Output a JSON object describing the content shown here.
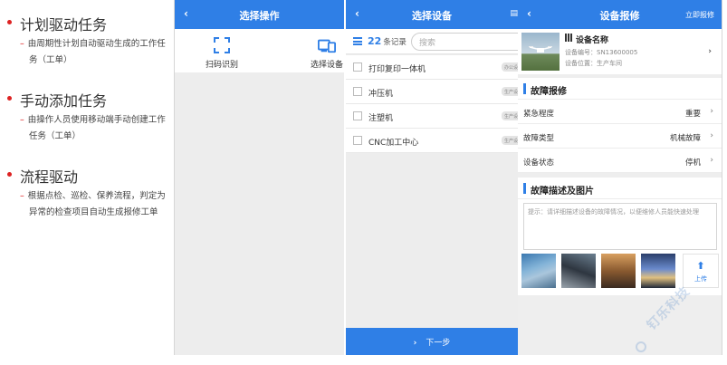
{
  "slide": {
    "bullets": [
      {
        "title": "计划驱动任务",
        "lines": [
          "由周期性计划自动驱动生成的工作任",
          "务（工单）"
        ]
      },
      {
        "title": "手动添加任务",
        "lines": [
          "由操作人员使用移动端手动创建工作",
          "任务（工单）"
        ]
      },
      {
        "title": "流程驱动",
        "lines": [
          "根据点检、巡检、保养流程，判定为",
          "异常的检查项目自动生成报修工单"
        ]
      }
    ]
  },
  "screen1": {
    "title": "选择操作",
    "operations": [
      {
        "label": "扫码识别",
        "icon": "scan-icon"
      },
      {
        "label": "选择设备",
        "icon": "device-select-icon"
      }
    ]
  },
  "screen2": {
    "title": "选择设备",
    "count": "22",
    "count_unit": "条记录",
    "search_placeholder": "搜索",
    "devices": [
      {
        "name": "打印复印一体机",
        "tag": "办公设备"
      },
      {
        "name": "冲压机",
        "tag": "生产设备"
      },
      {
        "name": "注塑机",
        "tag": "生产设备"
      },
      {
        "name": "CNC加工中心",
        "tag": "生产设备"
      }
    ],
    "next_label": "下一步"
  },
  "screen3": {
    "title": "设备报修",
    "right_link": "立即报修",
    "device": {
      "name": "设备名称",
      "code": "设备编号：SN13600005",
      "location": "设备位置：生产车间"
    },
    "section_fault": "故障报修",
    "rows": [
      {
        "label": "紧急程度",
        "value": "重要"
      },
      {
        "label": "故障类型",
        "value": "机械故障"
      },
      {
        "label": "设备状态",
        "value": "停机"
      }
    ],
    "section_desc": "故障描述及图片",
    "desc_placeholder": "提示：请详细描述设备的故障情况，以便维修人员能快速处理",
    "upload_label": "上传"
  },
  "watermark": "钉乐科技",
  "colors": {
    "accent": "#2f7fe6",
    "bullet": "#dd2222"
  }
}
